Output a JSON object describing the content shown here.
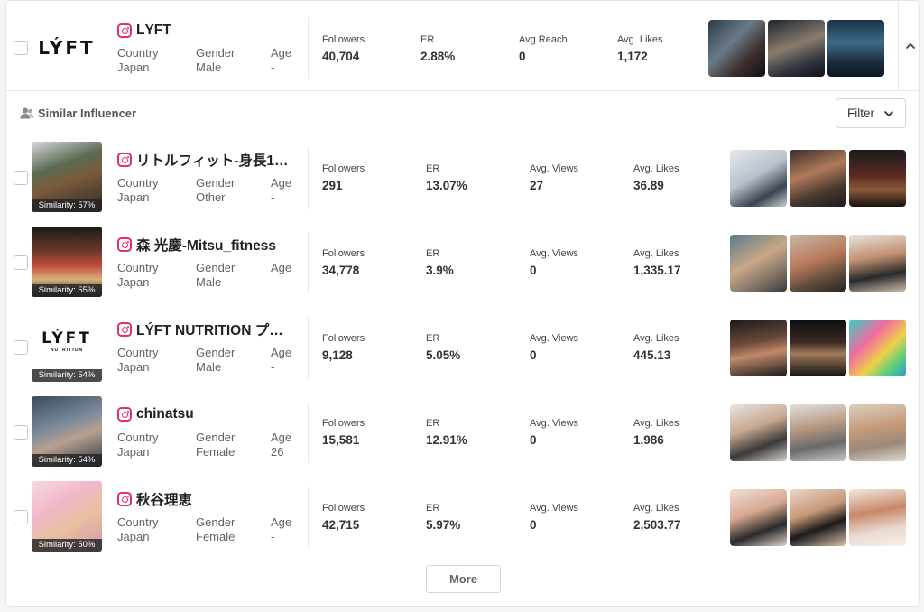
{
  "colors": {
    "accent_instagram": "#e1306c",
    "border": "#e5e7eb",
    "text_primary": "#222222",
    "text_meta": "#5f6368"
  },
  "main_influencer": {
    "logo_text": "LÝFT",
    "name": "LÝFT",
    "country_label": "Country",
    "country": "Japan",
    "gender_label": "Gender",
    "gender": "Male",
    "age_label": "Age",
    "age": "-",
    "stats": [
      {
        "label": "Followers",
        "value": "40,704"
      },
      {
        "label": "ER",
        "value": "2.88%"
      },
      {
        "label": "Avg Reach",
        "value": "0"
      },
      {
        "label": "Avg. Likes",
        "value": "1,172"
      }
    ],
    "collapse_icon": "chevron-up-icon"
  },
  "similar_section": {
    "title": "Similar Influencer",
    "icon": "users-icon",
    "filter_label": "Filter",
    "more_label": "More"
  },
  "similar": [
    {
      "name": "リトルフィット-身長1…",
      "similarity": "Similarity: 57%",
      "country_label": "Country",
      "country": "Japan",
      "gender_label": "Gender",
      "gender": "Other",
      "age_label": "Age",
      "age": "-",
      "stats": [
        {
          "label": "Followers",
          "value": "291"
        },
        {
          "label": "ER",
          "value": "13.07%"
        },
        {
          "label": "Avg. Views",
          "value": "27"
        },
        {
          "label": "Avg. Likes",
          "value": "36.89"
        }
      ]
    },
    {
      "name": "森 光慶-Mitsu_fitness",
      "similarity": "Similarity: 55%",
      "country_label": "Country",
      "country": "Japan",
      "gender_label": "Gender",
      "gender": "Male",
      "age_label": "Age",
      "age": "-",
      "stats": [
        {
          "label": "Followers",
          "value": "34,778"
        },
        {
          "label": "ER",
          "value": "3.9%"
        },
        {
          "label": "Avg. Views",
          "value": "0"
        },
        {
          "label": "Avg. Likes",
          "value": "1,335.17"
        }
      ]
    },
    {
      "name": "LÝFT NUTRITION プ…",
      "logo_text": "LÝFT",
      "logo_sub": "NUTRITION",
      "similarity": "Similarity: 54%",
      "country_label": "Country",
      "country": "Japan",
      "gender_label": "Gender",
      "gender": "Male",
      "age_label": "Age",
      "age": "-",
      "stats": [
        {
          "label": "Followers",
          "value": "9,128"
        },
        {
          "label": "ER",
          "value": "5.05%"
        },
        {
          "label": "Avg. Views",
          "value": "0"
        },
        {
          "label": "Avg. Likes",
          "value": "445.13"
        }
      ]
    },
    {
      "name": "chinatsu",
      "similarity": "Similarity: 54%",
      "country_label": "Country",
      "country": "Japan",
      "gender_label": "Gender",
      "gender": "Female",
      "age_label": "Age",
      "age": "26",
      "stats": [
        {
          "label": "Followers",
          "value": "15,581"
        },
        {
          "label": "ER",
          "value": "12.91%"
        },
        {
          "label": "Avg. Views",
          "value": "0"
        },
        {
          "label": "Avg. Likes",
          "value": "1,986"
        }
      ]
    },
    {
      "name": "秋谷理恵",
      "similarity": "Similarity: 50%",
      "country_label": "Country",
      "country": "Japan",
      "gender_label": "Gender",
      "gender": "Female",
      "age_label": "Age",
      "age": "-",
      "stats": [
        {
          "label": "Followers",
          "value": "42,715"
        },
        {
          "label": "ER",
          "value": "5.97%"
        },
        {
          "label": "Avg. Views",
          "value": "0"
        },
        {
          "label": "Avg. Likes",
          "value": "2,503.77"
        }
      ]
    }
  ]
}
